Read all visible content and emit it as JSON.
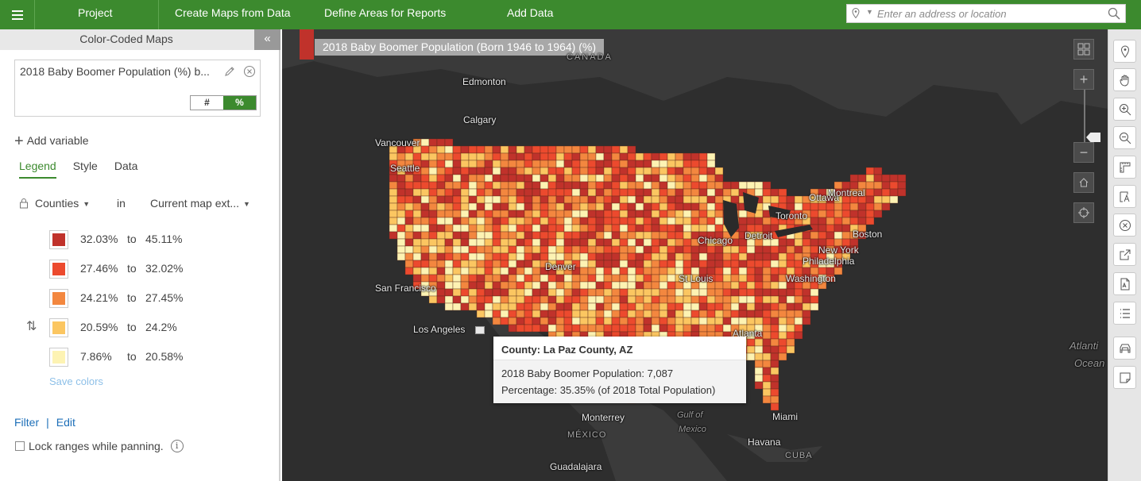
{
  "topbar": {
    "nav": [
      "Project",
      "Create Maps from Data",
      "Define Areas for Reports",
      "Add Data"
    ],
    "search_placeholder": "Enter an address or location"
  },
  "panel": {
    "title": "Color-Coded Maps",
    "collapse_glyph": "«",
    "variable": {
      "name": "2018 Baby Boomer Population (%) b...",
      "toggle_count": "#",
      "toggle_percent": "%",
      "selected": "%"
    },
    "add_variable": "Add variable",
    "tabs": [
      "Legend",
      "Style",
      "Data"
    ],
    "active_tab": "Legend",
    "geography_level": "Counties",
    "in_label": "in",
    "extent": "Current map ext...",
    "legend": [
      {
        "from": "32.03%",
        "to_label": "to",
        "to": "45.11%",
        "color": "#c0322b"
      },
      {
        "from": "27.46%",
        "to_label": "to",
        "to": "32.02%",
        "color": "#ec4a2e"
      },
      {
        "from": "24.21%",
        "to_label": "to",
        "to": "27.45%",
        "color": "#f3873f"
      },
      {
        "from": "20.59%",
        "to_label": "to",
        "to": "24.2%",
        "color": "#fbc661"
      },
      {
        "from": "7.86%",
        "to_label": "to",
        "to": "20.58%",
        "color": "#fdf3b3"
      }
    ],
    "save_colors": "Save colors",
    "filter": "Filter",
    "filter_sep": "|",
    "edit": "Edit",
    "lock_ranges": "Lock ranges while panning."
  },
  "map": {
    "title": "2018 Baby Boomer Population (Born 1946 to 1964) (%)",
    "labels": {
      "canada": "CANADA",
      "edmonton": "Edmonton",
      "calgary": "Calgary",
      "vancouver": "Vancouver",
      "seattle": "Seattle",
      "ottawa": "Ottawa",
      "montreal": "Montreal",
      "toronto": "Toronto",
      "detroit": "Detroit",
      "chicago": "Chicago",
      "boston": "Boston",
      "new_york": "New York",
      "philadelphia": "Philadelphia",
      "washington": "Washington",
      "denver": "Denver",
      "st_louis": "St Louis",
      "san_francisco": "San Francisco",
      "los_angeles": "Los Angeles",
      "atlanta": "Atlanta",
      "miami": "Miami",
      "havana": "Havana",
      "cuba": "CUBA",
      "monterrey": "Monterrey",
      "mexico": "MÉXICO",
      "guadalajara": "Guadalajara",
      "gulf1": "Gulf of",
      "gulf2": "Mexico",
      "atlantic1": "Atlanti",
      "atlantic2": "Ocean"
    },
    "popup": {
      "title": "County: La Paz County, AZ",
      "line1": "2018 Baby Boomer Population:  7,087",
      "line2": "Percentage:  35.35% (of 2018 Total Population)"
    },
    "zoom_in": "+",
    "zoom_out": "−"
  },
  "toolbar_icons": [
    "pin-icon",
    "pan-hand-icon",
    "zoom-in-icon",
    "zoom-out-icon",
    "measure-icon",
    "text-annotation-icon",
    "clear-icon",
    "share-icon",
    "export-pdf-icon",
    "list-icon",
    "car-drive-time-icon",
    "note-icon"
  ]
}
